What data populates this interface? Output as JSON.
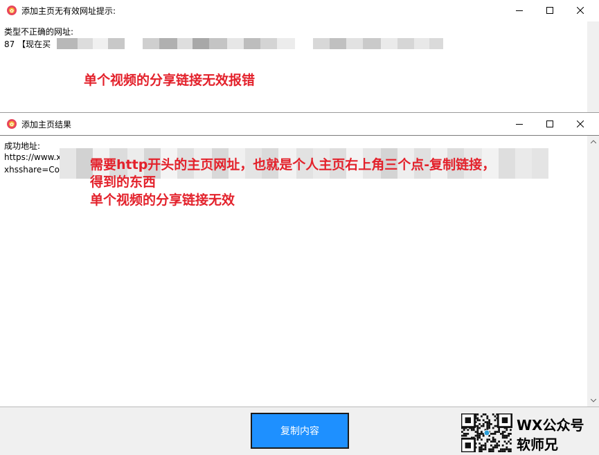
{
  "window1": {
    "title": "添加主页无有效网址提示:",
    "line1": "类型不正确的网址:",
    "line2": "87 【现在买"
  },
  "window2": {
    "title": "添加主页结果",
    "line1": "成功地址:",
    "line2": "https://www.x",
    "line3": "xhsshare=Co"
  },
  "annotations": {
    "top": "单个视频的分享链接无效报错",
    "mid1": "需要http开头的主页网址，也就是个人主页右上角三个点-复制链接，",
    "mid2": "得到的东西",
    "mid3": "单个视频的分享链接无效"
  },
  "footer": {
    "copy_button": "复制内容",
    "wx_line1": "WX公众号",
    "wx_line2": "软师兄"
  },
  "colors": {
    "annotation": "#e3212b",
    "button": "#1e90ff",
    "chrome": "#f0f0f0"
  },
  "icons": [
    "app-icon",
    "minimize-icon",
    "maximize-icon",
    "close-icon",
    "scroll-up-icon",
    "scroll-down-icon",
    "qr-code"
  ]
}
